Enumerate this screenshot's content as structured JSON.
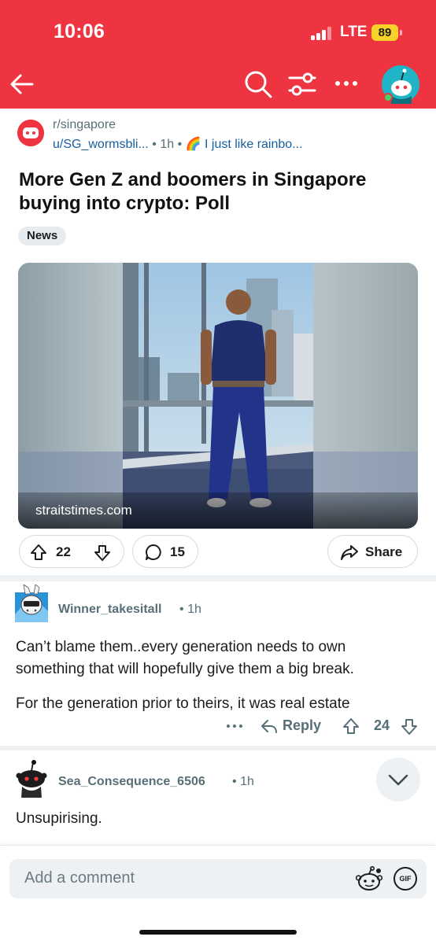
{
  "status_bar": {
    "time": "10:06",
    "network": "LTE",
    "battery": "89"
  },
  "header": {
    "icons": [
      "back-arrow-icon",
      "search-icon",
      "filter-icon",
      "more-icon",
      "avatar-icon"
    ],
    "accent_color": "#ee3440"
  },
  "post": {
    "subreddit": "r/singapore",
    "author": "u/SG_wormsbli...",
    "separator": "•",
    "time": "1h",
    "flair_emoji": "🌈",
    "flair_text": "I just like rainbo...",
    "title": "More Gen Z and boomers in Singapore buying into crypto: Poll",
    "tag": "News",
    "link_domain": "straitstimes.com",
    "upvotes": "22",
    "comments": "15",
    "share_label": "Share"
  },
  "comments": [
    {
      "author": "Winner_takesitall",
      "time": "1h",
      "paragraphs": [
        "Can’t blame them..every generation needs to own something that will hopefully give them a big break.",
        "For the generation prior to theirs, it was real estate"
      ],
      "reply_label": "Reply",
      "score": "24"
    },
    {
      "author": "Sea_Consequence_6506",
      "time": "1h",
      "paragraphs": [
        "Unsupirising."
      ]
    }
  ],
  "composer": {
    "placeholder": "Add a comment",
    "gif_label": "GIF"
  }
}
